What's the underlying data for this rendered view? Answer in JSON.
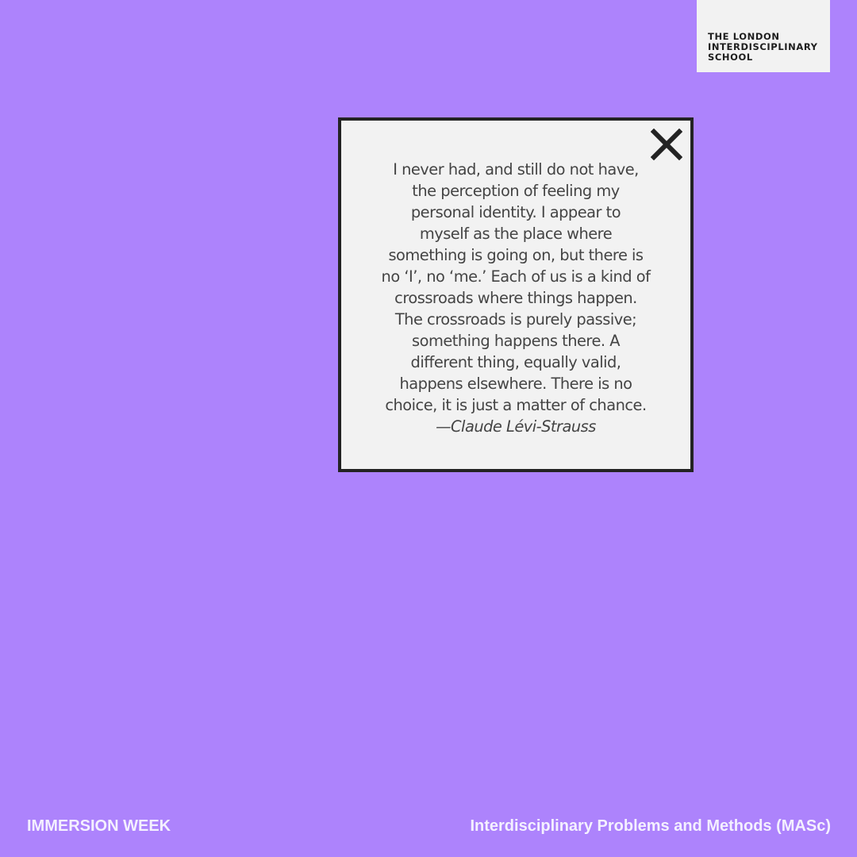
{
  "colors": {
    "background": "#ad83fc",
    "panel": "#f2f2f2",
    "border": "#232323",
    "quote_text": "#444444",
    "footer_text": "#f4f0ff"
  },
  "logo": {
    "lines": [
      "THE LONDON",
      "INTERDISCIPLINARY",
      "SCHOOL"
    ]
  },
  "dialog": {
    "close_icon": "close-icon",
    "quote_lines": [
      "I never had, and still do not have,",
      "the perception of feeling my",
      "personal identity. I appear to",
      "myself as the place where",
      "something is going on, but there is",
      "no ‘I’, no ‘me.’ Each of us is a kind of",
      "crossroads where things happen.",
      "The crossroads is purely passive;",
      "something happens there. A",
      "different thing, equally valid,",
      "happens elsewhere. There is no",
      "choice, it is just a matter of chance."
    ],
    "author": "—Claude Lévi-Strauss"
  },
  "footer": {
    "left": "IMMERSION WEEK",
    "right": "Interdisciplinary Problems and Methods (MASc)"
  }
}
